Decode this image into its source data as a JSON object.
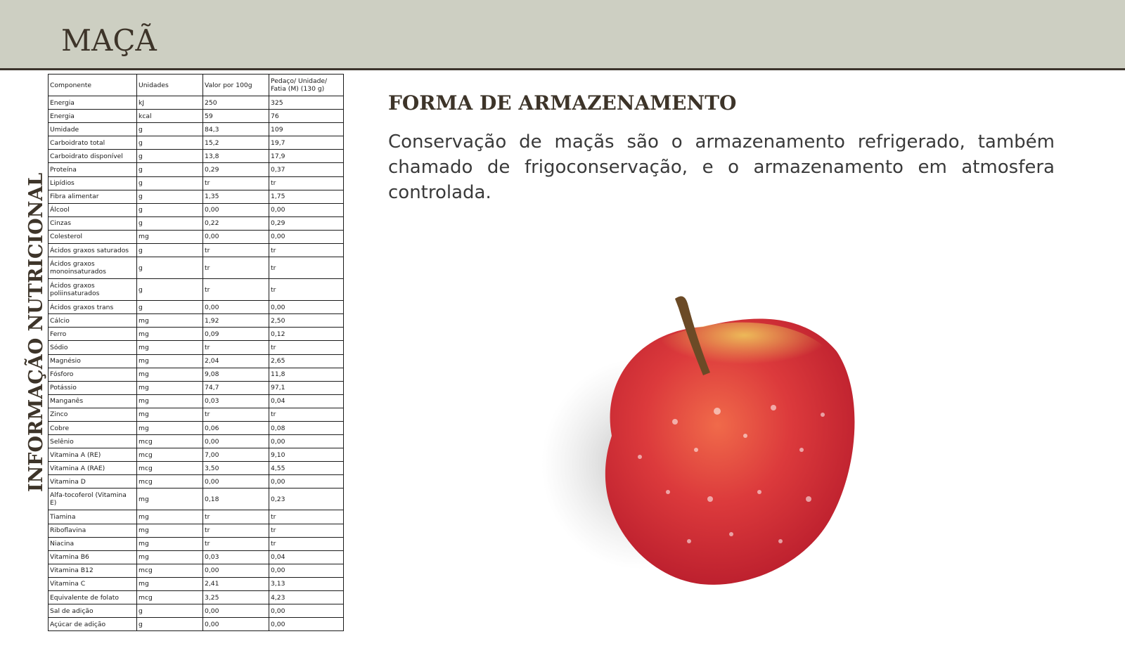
{
  "page": {
    "title": "MAÇÃ",
    "side_label": "INFORMAÇÃO NUTRICIONAL"
  },
  "storage": {
    "heading": "FORMA DE ARMAZENAMENTO",
    "text": "Conservação de maçãs são o armazenamento refrigerado, também chamado de frigoconservação, e o armazenamento em atmosfera controlada."
  },
  "table": {
    "headers": [
      "Componente",
      "Unidades",
      "Valor por 100g",
      "Pedaço/ Unidade/ Fatia (M) (130 g)"
    ],
    "rows": [
      [
        "Energia",
        "kJ",
        "250",
        "325"
      ],
      [
        "Energia",
        "kcal",
        "59",
        "76"
      ],
      [
        "Umidade",
        "g",
        "84,3",
        "109"
      ],
      [
        "Carboidrato total",
        "g",
        "15,2",
        "19,7"
      ],
      [
        "Carboidrato disponível",
        "g",
        "13,8",
        "17,9"
      ],
      [
        "Proteína",
        "g",
        "0,29",
        "0,37"
      ],
      [
        "Lipídios",
        "g",
        "tr",
        "tr"
      ],
      [
        "Fibra alimentar",
        "g",
        "1,35",
        "1,75"
      ],
      [
        "Álcool",
        "g",
        "0,00",
        "0,00"
      ],
      [
        "Cinzas",
        "g",
        "0,22",
        "0,29"
      ],
      [
        "Colesterol",
        "mg",
        "0,00",
        "0,00"
      ],
      [
        "Ácidos graxos saturados",
        "g",
        "tr",
        "tr"
      ],
      [
        "Ácidos graxos monoinsaturados",
        "g",
        "tr",
        "tr"
      ],
      [
        "Ácidos graxos poliinsaturados",
        "g",
        "tr",
        "tr"
      ],
      [
        "Ácidos graxos trans",
        "g",
        "0,00",
        "0,00"
      ],
      [
        "Cálcio",
        "mg",
        "1,92",
        "2,50"
      ],
      [
        "Ferro",
        "mg",
        "0,09",
        "0,12"
      ],
      [
        "Sódio",
        "mg",
        "tr",
        "tr"
      ],
      [
        "Magnésio",
        "mg",
        "2,04",
        "2,65"
      ],
      [
        "Fósforo",
        "mg",
        "9,08",
        "11,8"
      ],
      [
        "Potássio",
        "mg",
        "74,7",
        "97,1"
      ],
      [
        "Manganês",
        "mg",
        "0,03",
        "0,04"
      ],
      [
        "Zinco",
        "mg",
        "tr",
        "tr"
      ],
      [
        "Cobre",
        "mg",
        "0,06",
        "0,08"
      ],
      [
        "Selênio",
        "mcg",
        "0,00",
        "0,00"
      ],
      [
        "Vitamina A (RE)",
        "mcg",
        "7,00",
        "9,10"
      ],
      [
        "Vitamina A (RAE)",
        "mcg",
        "3,50",
        "4,55"
      ],
      [
        "Vitamina D",
        "mcg",
        "0,00",
        "0,00"
      ],
      [
        "Alfa-tocoferol (Vitamina E)",
        "mg",
        "0,18",
        "0,23"
      ],
      [
        "Tiamina",
        "mg",
        "tr",
        "tr"
      ],
      [
        "Riboflavina",
        "mg",
        "tr",
        "tr"
      ],
      [
        "Niacina",
        "mg",
        "tr",
        "tr"
      ],
      [
        "Vitamina B6",
        "mg",
        "0,03",
        "0,04"
      ],
      [
        "Vitamina B12",
        "mcg",
        "0,00",
        "0,00"
      ],
      [
        "Vitamina C",
        "mg",
        "2,41",
        "3,13"
      ],
      [
        "Equivalente de folato",
        "mcg",
        "3,25",
        "4,23"
      ],
      [
        "Sal de adição",
        "g",
        "0,00",
        "0,00"
      ],
      [
        "Açúcar de adição",
        "g",
        "0,00",
        "0,00"
      ]
    ]
  },
  "colors": {
    "header_band": "#cdcfc2",
    "title_text": "#3d3429",
    "apple_red": "#d42a33",
    "apple_yellow": "#e8b04a"
  },
  "image": {
    "icon": "apple-photo-icon"
  }
}
